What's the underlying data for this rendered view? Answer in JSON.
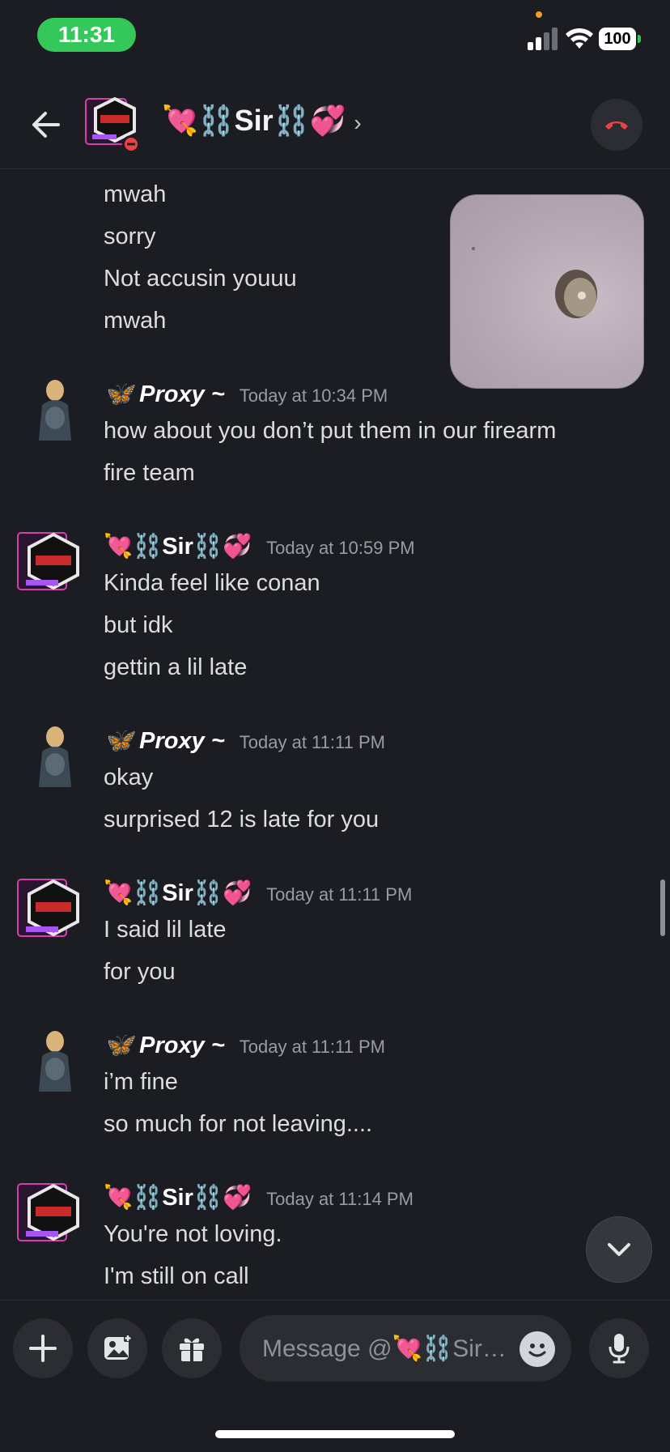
{
  "status_bar": {
    "time": "11:31",
    "battery": "100"
  },
  "header": {
    "contact_name": "💘⛓️Sir⛓️💞",
    "caret": "›"
  },
  "messages": {
    "continuation_lines": [
      "mwah",
      "sorry",
      "Not accusin youuu",
      "mwah"
    ],
    "groups": [
      {
        "author": "🦋 Proxy ~",
        "timestamp": "Today at 10:34 PM",
        "lines": [
          "how about you don’t put them in our firearm",
          "fire team"
        ]
      },
      {
        "author": "💘⛓️Sir⛓️💞",
        "timestamp": "Today at 10:59 PM",
        "lines": [
          "Kinda feel like conan",
          "but idk",
          "gettin a lil late"
        ]
      },
      {
        "author": "🦋 Proxy ~",
        "timestamp": "Today at 11:11 PM",
        "lines": [
          "okay",
          "surprised 12 is late for you"
        ]
      },
      {
        "author": "💘⛓️Sir⛓️💞",
        "timestamp": "Today at 11:11 PM",
        "lines": [
          "I said lil late",
          "for you"
        ]
      },
      {
        "author": "🦋 Proxy ~",
        "timestamp": "Today at 11:11 PM",
        "lines": [
          "i’m fine",
          "so much for not leaving...."
        ]
      },
      {
        "author": "💘⛓️Sir⛓️💞",
        "timestamp": "Today at 11:14 PM",
        "lines": [
          "You're not loving.",
          "I'm still on call"
        ]
      }
    ]
  },
  "composer": {
    "placeholder": "Message @💘⛓️Sir…"
  },
  "icons": {
    "back": "arrow-left-icon",
    "end_call": "phone-hangup-icon",
    "add": "plus-icon",
    "gallery": "image-icon",
    "gift": "gift-icon",
    "emoji": "emoji-icon",
    "mic": "microphone-icon",
    "jump": "chevron-down-icon"
  },
  "colors": {
    "status_green": "#34c759",
    "end_call_red": "#ed4245",
    "background": "#1c1d22"
  }
}
